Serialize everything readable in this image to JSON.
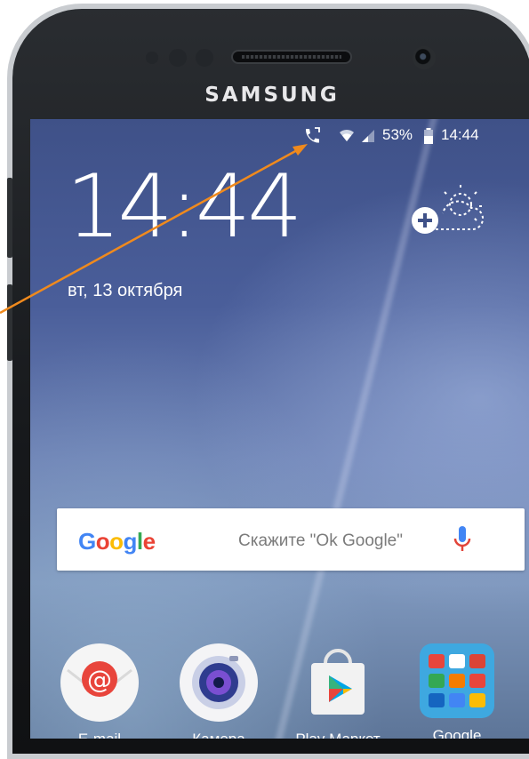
{
  "device": {
    "brand": "SAMSUNG"
  },
  "status_bar": {
    "battery": "53%",
    "time": "14:44"
  },
  "lockscreen": {
    "clock": "14:44",
    "date": "вт, 13 октября"
  },
  "search_widget": {
    "logo": "Google",
    "hint": "Скажите \"Ok Google\""
  },
  "apps": [
    {
      "label": "E-mail",
      "icon": "email-icon"
    },
    {
      "label": "Камера",
      "icon": "camera-icon"
    },
    {
      "label": "Play Маркет",
      "icon": "play-store-icon"
    },
    {
      "label": "Google",
      "icon": "google-folder-icon"
    }
  ],
  "colors": {
    "annotation_arrow": "#f08a1d",
    "mic": "#e2453a"
  }
}
